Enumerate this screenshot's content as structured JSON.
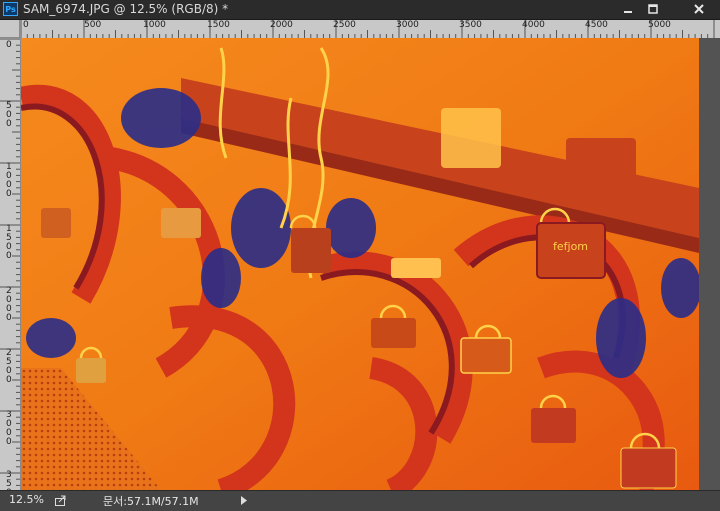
{
  "window": {
    "title": "SAM_6974.JPG @ 12.5% (RGB/8) *",
    "app_icon_label": "Ps"
  },
  "ruler": {
    "top_labels": [
      "0",
      "500",
      "1000",
      "1500",
      "2000",
      "2500",
      "3000",
      "3500",
      "4000",
      "4500",
      "5000"
    ],
    "left_labels": [
      "0",
      "500",
      "1000",
      "1500",
      "2000",
      "2500",
      "3000",
      "3500"
    ]
  },
  "status": {
    "zoom": "12.5%",
    "doc_info": "문서:57.1M/57.1M"
  },
  "colors": {
    "accent": "#31a8ff",
    "image_orange": "#f07a14",
    "image_red": "#e0301a",
    "image_navy": "#2a2d88",
    "image_yellow": "#ffd24a"
  },
  "image_text": {
    "lock_text": "fefjom"
  }
}
